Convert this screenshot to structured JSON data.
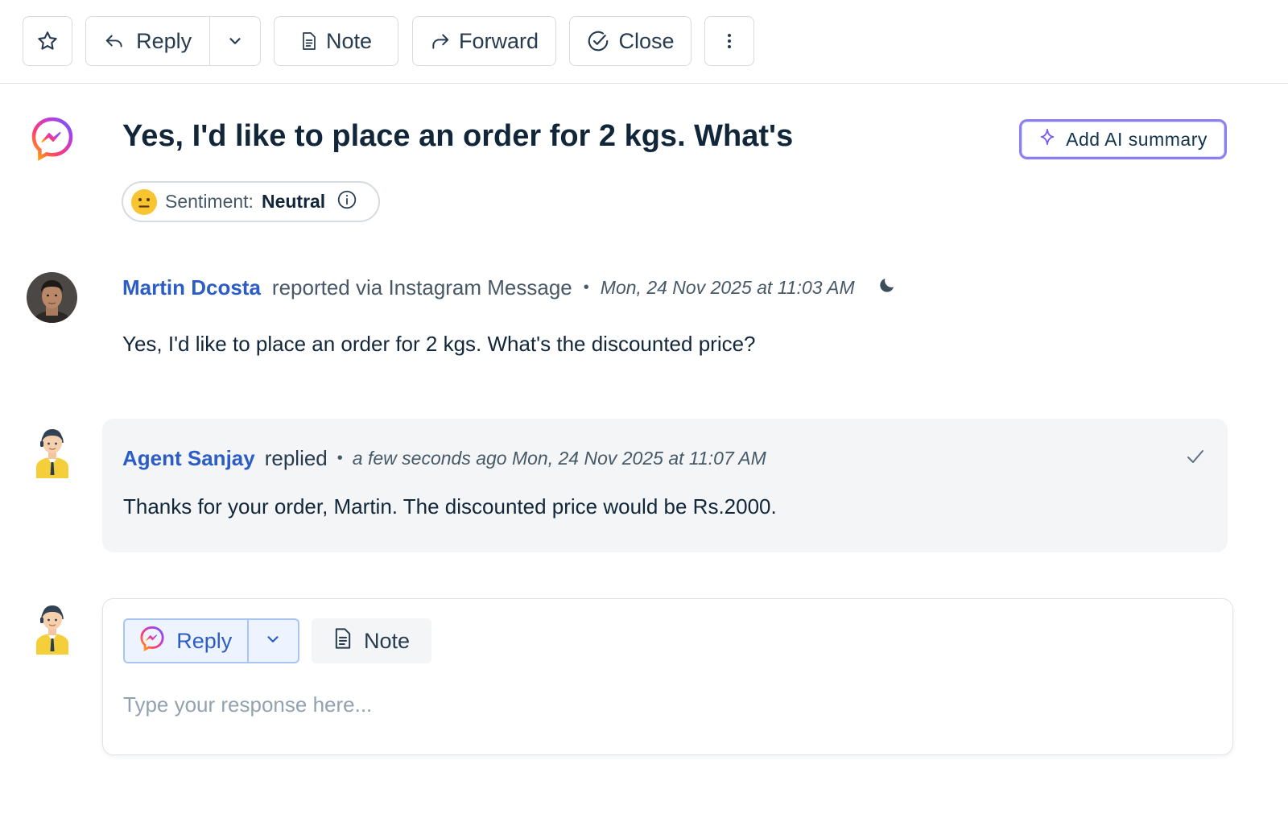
{
  "toolbar": {
    "star_icon": "star-icon",
    "reply_label": "Reply",
    "note_label": "Note",
    "forward_label": "Forward",
    "close_label": "Close",
    "more_icon": "more-vertical-icon"
  },
  "ticket": {
    "channel_icon": "messenger-icon",
    "title": "Yes, I'd like to place an order for 2 kgs. What's",
    "ai_summary_label": "Add AI summary",
    "sentiment_label": "Sentiment:",
    "sentiment_value": "Neutral"
  },
  "messages": [
    {
      "author": "Martin Dcosta",
      "action": "reported via Instagram Message",
      "separator": "•",
      "timestamp": "Mon, 24 Nov 2025 at 11:03 AM",
      "body": "Yes, I'd like to place an order for 2 kgs. What's the discounted price?"
    },
    {
      "author": "Agent Sanjay",
      "action": "replied",
      "separator": "•",
      "timestamp": "a few seconds ago Mon, 24 Nov 2025 at 11:07 AM",
      "body": "Thanks for your order, Martin. The discounted price would be Rs.2000."
    }
  ],
  "composer": {
    "reply_label": "Reply",
    "note_label": "Note",
    "placeholder": "Type your response here..."
  },
  "colors": {
    "link_blue": "#2c5cc5",
    "ai_border": "#8f7cf0",
    "reply_bg": "#f3f5f7"
  }
}
